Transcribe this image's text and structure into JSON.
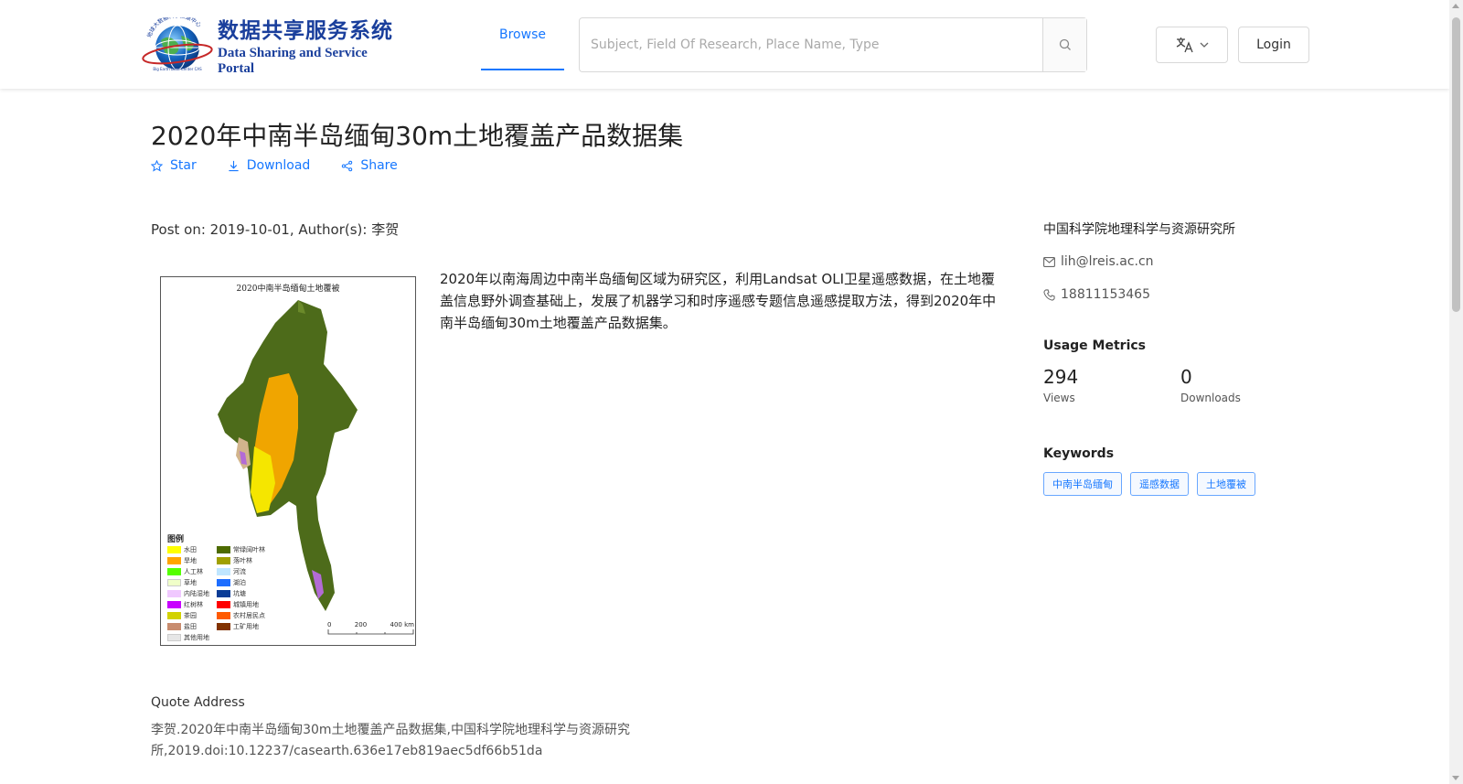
{
  "header": {
    "logo_cn": "数据共享服务系统",
    "logo_en": "Data Sharing and Service Portal",
    "logo_arc_text": "地球大数据科学数据中心",
    "logo_small_text": "Big Earth Data Center CAS",
    "nav_browse": "Browse",
    "search_placeholder": "Subject, Field Of Research, Place Name, Type",
    "login_label": "Login"
  },
  "dataset": {
    "title": "2020年中南半岛缅甸30m土地覆盖产品数据集",
    "actions": {
      "star": "Star",
      "download": "Download",
      "share": "Share"
    },
    "meta": "Post on: 2019-10-01, Author(s): 李贺",
    "description": "2020年以南海周边中南半岛缅甸区域为研究区，利用Landsat OLI卫星遥感数据，在土地覆盖信息野外调查基础上，发展了机器学习和时序遥感专题信息遥感提取方法，得到2020年中南半岛缅甸30m土地覆盖产品数据集。",
    "quote_label": "Quote Address",
    "quote_text": "李贺.2020年中南半岛缅甸30m土地覆盖产品数据集,中国科学院地理科学与资源研究所,2019.doi:10.12237/casearth.636e17eb819aec5df66b51da"
  },
  "thumbnail": {
    "title": "2020中南半岛缅甸土地覆被",
    "legend_title": "图例",
    "legend": [
      {
        "label": "水田",
        "color": "#ffff00"
      },
      {
        "label": "常绿阔叶林",
        "color": "#4d6b00"
      },
      {
        "label": "旱地",
        "color": "#ffa500"
      },
      {
        "label": "落叶林",
        "color": "#a0a000"
      },
      {
        "label": "人工林",
        "color": "#55ff00"
      },
      {
        "label": "河流",
        "color": "#bfe6ff"
      },
      {
        "label": "草地",
        "color": "#f0ffc8"
      },
      {
        "label": "湖泊",
        "color": "#1e6eff"
      },
      {
        "label": "内陆湿地",
        "color": "#f0c8ff"
      },
      {
        "label": "坑塘",
        "color": "#0a3c96"
      },
      {
        "label": "红树林",
        "color": "#c800ff"
      },
      {
        "label": "城镇用地",
        "color": "#ff0000"
      },
      {
        "label": "茶园",
        "color": "#d2d200"
      },
      {
        "label": "农村居民点",
        "color": "#ff5a00"
      },
      {
        "label": "盐田",
        "color": "#c88c6e"
      },
      {
        "label": "工矿用地",
        "color": "#823200"
      },
      {
        "label": "其他用地",
        "color": "#e6e6e6"
      }
    ],
    "scale_labels": [
      "0",
      "200",
      "400",
      "km"
    ]
  },
  "sidebar": {
    "org": "中国科学院地理科学与资源研究所",
    "email": "lih@lreis.ac.cn",
    "phone": "18811153465",
    "usage_title": "Usage Metrics",
    "views_value": "294",
    "views_label": "Views",
    "downloads_value": "0",
    "downloads_label": "Downloads",
    "keywords_title": "Keywords",
    "keywords": [
      "中南半岛缅甸",
      "遥感数据",
      "土地覆被"
    ]
  }
}
